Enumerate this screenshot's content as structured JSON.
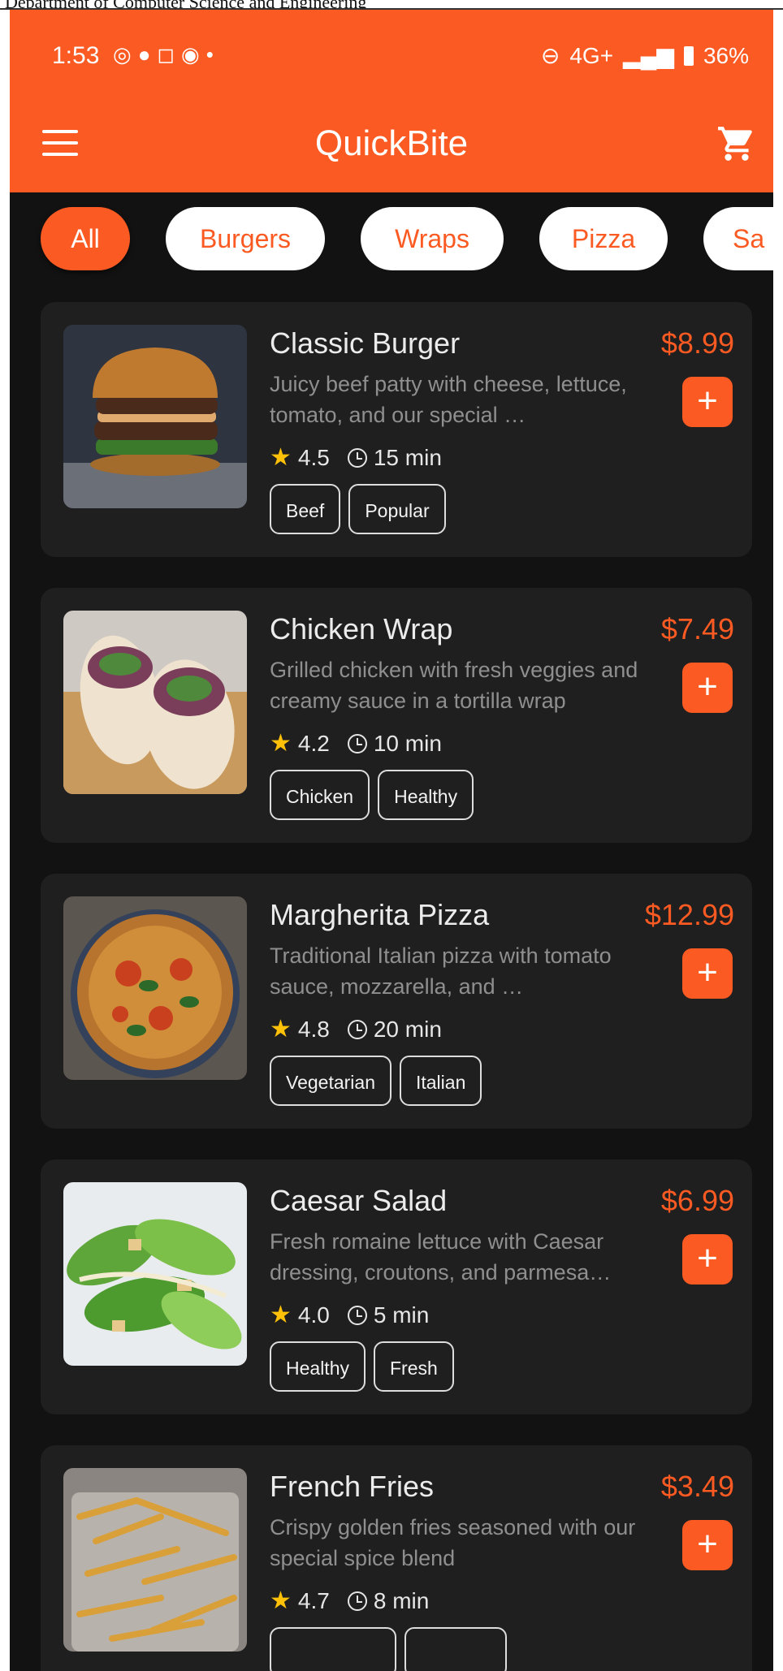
{
  "document": {
    "header_text": "Department of Computer Science and Engineering"
  },
  "status_bar": {
    "time": "1:53",
    "left_icons": [
      "whatsapp-icon",
      "chat-icon",
      "instagram-icon",
      "viber-icon",
      "dot-icon"
    ],
    "network": "4G+",
    "battery": "36%"
  },
  "app_bar": {
    "title": "QuickBite"
  },
  "categories": [
    {
      "label": "All",
      "active": true
    },
    {
      "label": "Burgers",
      "active": false
    },
    {
      "label": "Wraps",
      "active": false
    },
    {
      "label": "Pizza",
      "active": false
    },
    {
      "label": "Sa",
      "active": false
    }
  ],
  "items": [
    {
      "name": "Classic Burger",
      "price": "$8.99",
      "description": "Juicy beef patty with cheese, lettuce, tomato, and our special …",
      "rating": "4.5",
      "time": "15 min",
      "tags": [
        "Beef",
        "Popular"
      ]
    },
    {
      "name": "Chicken Wrap",
      "price": "$7.49",
      "description": "Grilled chicken with fresh veggies and creamy sauce in a tortilla wrap",
      "rating": "4.2",
      "time": "10 min",
      "tags": [
        "Chicken",
        "Healthy"
      ]
    },
    {
      "name": "Margherita Pizza",
      "price": "$12.99",
      "description": "Traditional Italian pizza with tomato sauce, mozzarella, and …",
      "rating": "4.8",
      "time": "20 min",
      "tags": [
        "Vegetarian",
        "Italian"
      ]
    },
    {
      "name": "Caesar Salad",
      "price": "$6.99",
      "description": "Fresh romaine lettuce with Caesar dressing, croutons, and parmesa…",
      "rating": "4.0",
      "time": "5 min",
      "tags": [
        "Healthy",
        "Fresh"
      ]
    },
    {
      "name": "French Fries",
      "price": "$3.49",
      "description": "Crispy golden fries seasoned with our special spice blend",
      "rating": "4.7",
      "time": "8 min",
      "tags": []
    }
  ],
  "colors": {
    "accent": "#fb5a22",
    "background": "#121212",
    "card": "#1f1f1f",
    "star": "#ffc107"
  },
  "add_button_label": "+",
  "star_glyph": "★"
}
